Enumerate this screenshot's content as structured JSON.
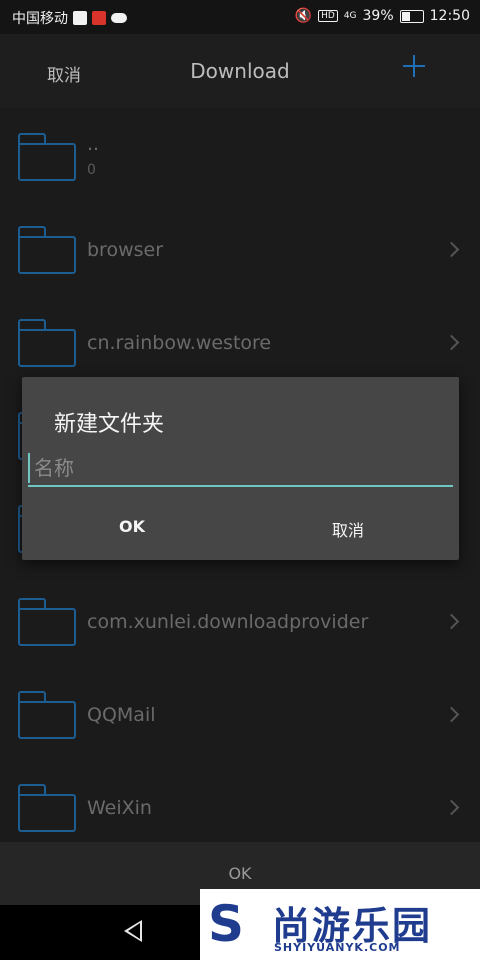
{
  "status_bar": {
    "carrier": "中国移动",
    "hd": "HD",
    "network": "4G",
    "battery": "39%",
    "time": "12:50"
  },
  "header": {
    "cancel_label": "取消",
    "title": "Download"
  },
  "folders": [
    {
      "name": "..",
      "sub": "0"
    },
    {
      "name": "browser"
    },
    {
      "name": "cn.rainbow.westore"
    },
    {
      "name": ""
    },
    {
      "name": ""
    },
    {
      "name": "com.xunlei.downloadprovider"
    },
    {
      "name": "QQMail"
    },
    {
      "name": "WeiXin"
    }
  ],
  "dialog": {
    "title": "新建文件夹",
    "input_placeholder": "名称",
    "input_value": "",
    "ok_label": "OK",
    "cancel_label": "取消"
  },
  "bottom": {
    "ok_label": "OK"
  },
  "watermark": {
    "letter": "S",
    "text": "尚游乐园",
    "url": "SHYIYUANYK.COM"
  },
  "colors": {
    "accent": "#6fc7c2",
    "folder_outline": "#1c5d92",
    "add_icon": "#1e6fb5",
    "dialog_bg": "#464646"
  }
}
